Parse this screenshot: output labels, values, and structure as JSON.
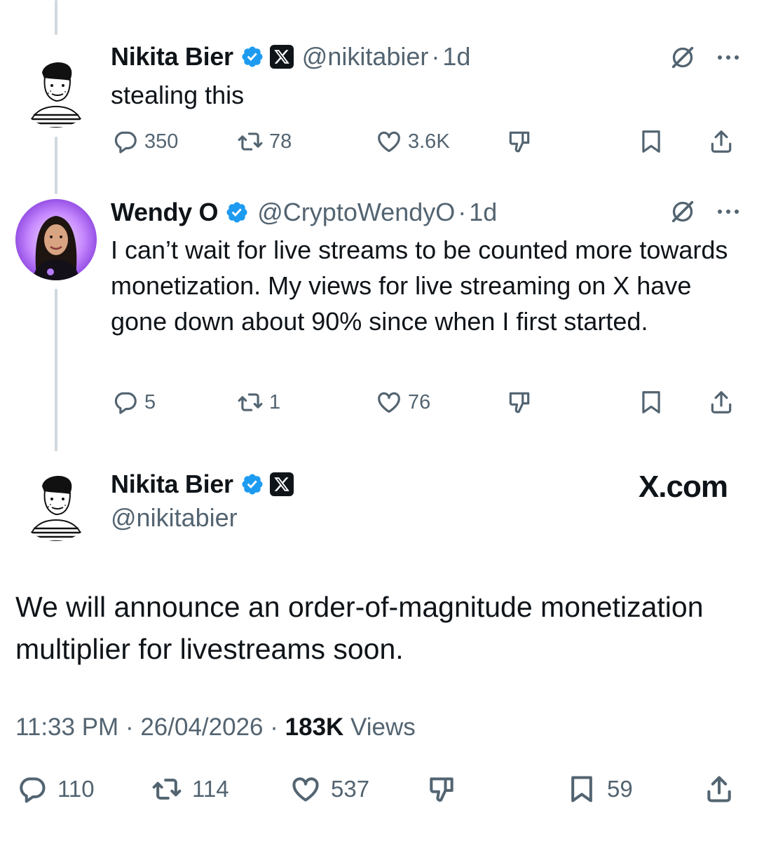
{
  "tweets": [
    {
      "name": "Nikita Bier",
      "handle": "@nikitabier",
      "separator": "·",
      "time": "1d",
      "text": "stealing this",
      "stats": {
        "replies": "350",
        "reposts": "78",
        "likes": "3.6K"
      }
    },
    {
      "name": "Wendy O",
      "handle": "@CryptoWendyO",
      "separator": "·",
      "time": "1d",
      "text": "I can’t wait for live streams to be counted more towards monetization. My views for live streaming on X have gone down about 90% since when I first started.",
      "stats": {
        "replies": "5",
        "reposts": "1",
        "likes": "76"
      }
    }
  ],
  "main": {
    "name": "Nikita Bier",
    "handle": "@nikitabier",
    "brand": "X.com",
    "text": "We will announce an order-of-magnitude monetization multiplier for livestreams soon.",
    "timestamp": "11:33 PM",
    "sep1": "·",
    "date": "26/04/2026",
    "sep2": "·",
    "views_count": "183K",
    "views_label": "Views",
    "stats": {
      "replies": "110",
      "reposts": "114",
      "likes": "537",
      "bookmarks": "59"
    }
  },
  "icons": [
    "verified-badge-icon",
    "x-affiliate-icon",
    "grok-icon",
    "more-icon",
    "reply-icon",
    "repost-icon",
    "like-icon",
    "dislike-icon",
    "bookmark-icon",
    "share-icon"
  ],
  "colors": {
    "verified": "#1d9bf0",
    "text": "#0f1419",
    "muted": "#536471",
    "thread_line": "#cfd9de"
  }
}
